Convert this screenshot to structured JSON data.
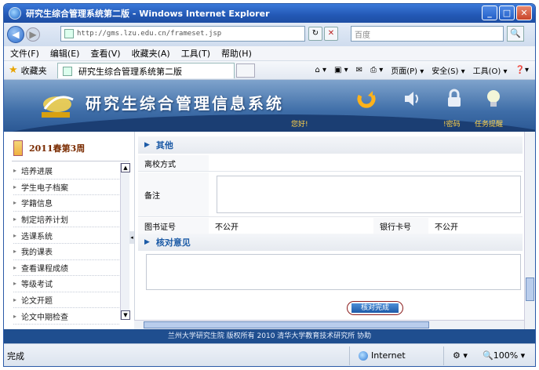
{
  "window": {
    "title": "研究生综合管理系统第二版 - Windows Internet Explorer",
    "btn_min": "_",
    "btn_max": "□",
    "btn_close": "✕"
  },
  "address": {
    "back": "◀",
    "forward": "▶",
    "url": "http://gms.lzu.edu.cn/frameset.jsp",
    "refresh": "↻",
    "stop": "✕",
    "search_placeholder": "百度",
    "search_btn": "🔍"
  },
  "menu": [
    "文件(F)",
    "编辑(E)",
    "查看(V)",
    "收藏夹(A)",
    "工具(T)",
    "帮助(H)"
  ],
  "favorites": {
    "label": "收藏夹",
    "tab_title": "研究生综合管理系统第二版"
  },
  "toolbar": {
    "page": "页面(P) ▾",
    "security": "安全(S) ▾",
    "tools": "工具(O) ▾",
    "help": "❓▾"
  },
  "banner": {
    "system_name": "研究生综合管理信息系统",
    "hello": "您好!",
    "password_link": "!密码",
    "tasks_link": "任务提醒"
  },
  "sidebar": {
    "term": "2011春第3周",
    "items": [
      "培养进展",
      "学生电子档案",
      "学籍信息",
      "制定培养计划",
      "选课系统",
      "我的课表",
      "查看课程成绩",
      "等级考试",
      "论文开题",
      "论文中期检查"
    ]
  },
  "form": {
    "section_other": "其他",
    "leave_mode_label": "离校方式",
    "leave_mode_value": "",
    "remark_label": "备注",
    "library_card_label": "图书证号",
    "library_card_value": "不公开",
    "bank_card_label": "银行卡号",
    "bank_card_value": "不公开",
    "section_review": "核对意见",
    "confirm_label": "核对完成"
  },
  "footer": {
    "text": "兰州大学研究生院 版权所有 2010 清华大学教育技术研究所 协助"
  },
  "status": {
    "left": "完成",
    "zone": "Internet",
    "zoom": "100%"
  },
  "colors": {
    "banner_dark": "#1b3e73",
    "footer": "#1f4e8f",
    "accent_text": "#1b5aa6"
  }
}
